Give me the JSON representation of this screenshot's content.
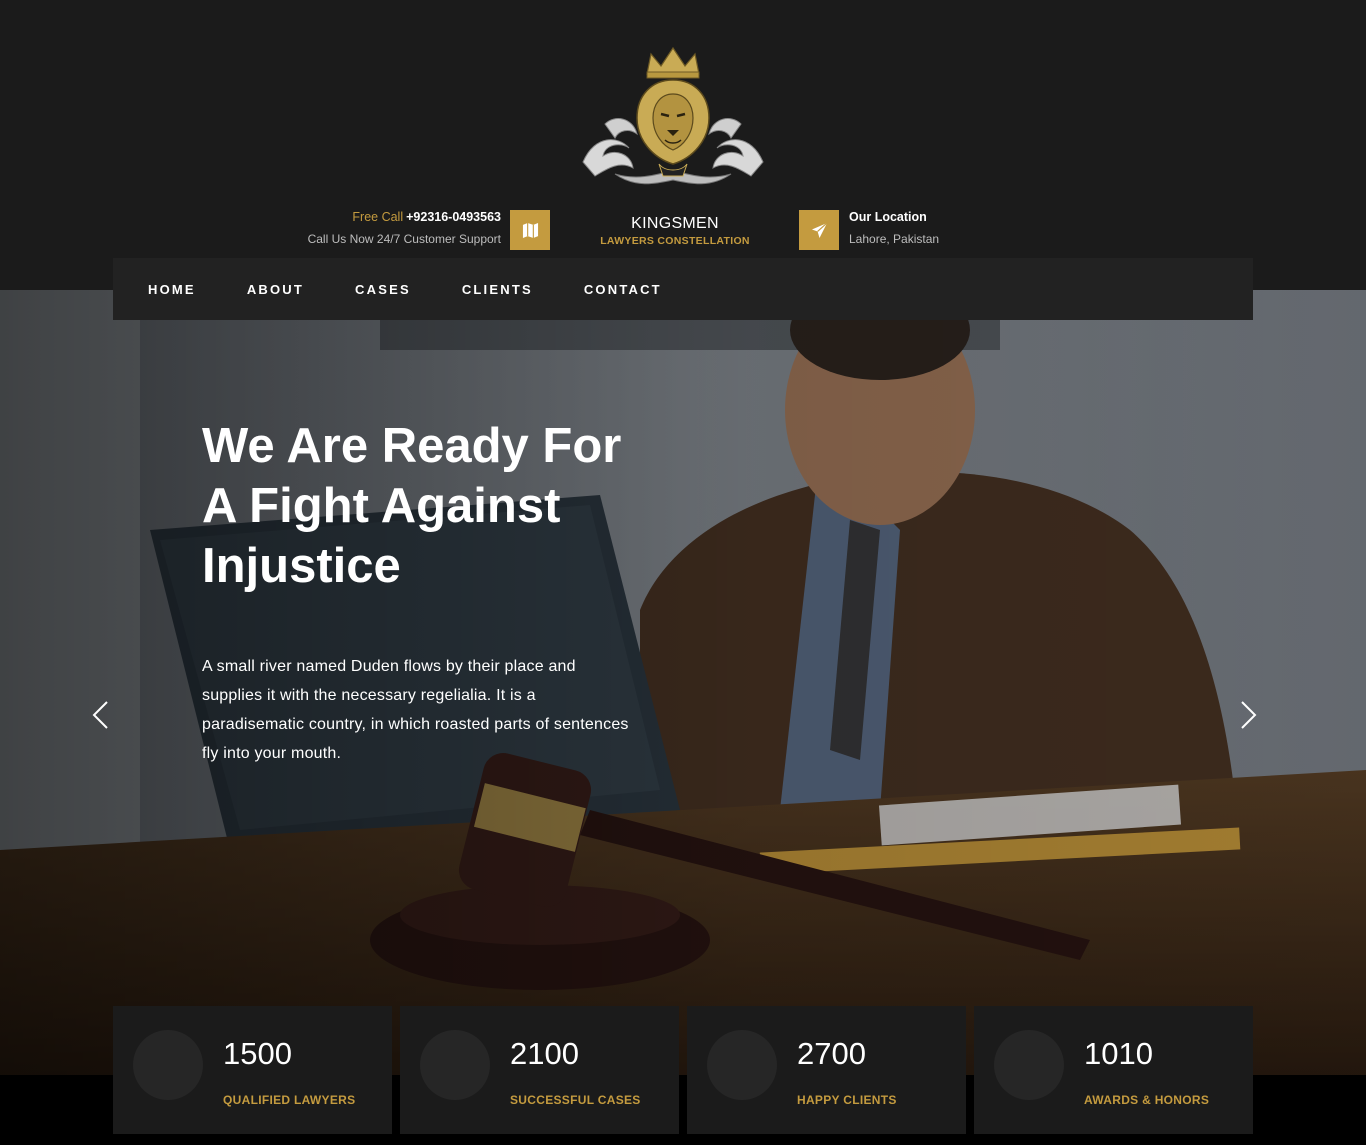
{
  "header": {
    "call_label": "Free Call",
    "phone": "+92316-0493563",
    "support_text": "Call Us Now 24/7 Customer Support",
    "brand_name": "KINGSMEN",
    "brand_sub": "LAWYERS CONSTELLATION",
    "location_label": "Our Location",
    "location_value": "Lahore, Pakistan",
    "icons": [
      "map-icon",
      "paper-plane-icon"
    ],
    "logo": "gold-lion-crest-logo"
  },
  "nav": {
    "items": [
      {
        "label": "HOME"
      },
      {
        "label": "ABOUT"
      },
      {
        "label": "CASES"
      },
      {
        "label": "CLIENTS"
      },
      {
        "label": "CONTACT"
      }
    ]
  },
  "hero": {
    "headline_lines": [
      "We Are Ready For",
      "A Fight Against",
      "Injustice"
    ],
    "description": "A small river named Duden flows by their place and supplies it with the necessary regelialia. It is a paradisematic country, in which roasted parts of sentences fly into your mouth."
  },
  "stats": [
    {
      "value": "1500",
      "label": "QUALIFIED LAWYERS"
    },
    {
      "value": "2100",
      "label": "SUCCESSFUL CASES"
    },
    {
      "value": "2700",
      "label": "HAPPY CLIENTS"
    },
    {
      "value": "1010",
      "label": "AWARDS & HONORS"
    }
  ],
  "colors": {
    "accent": "#c49b3f",
    "dark": "#1b1b1b",
    "nav": "#222222"
  }
}
